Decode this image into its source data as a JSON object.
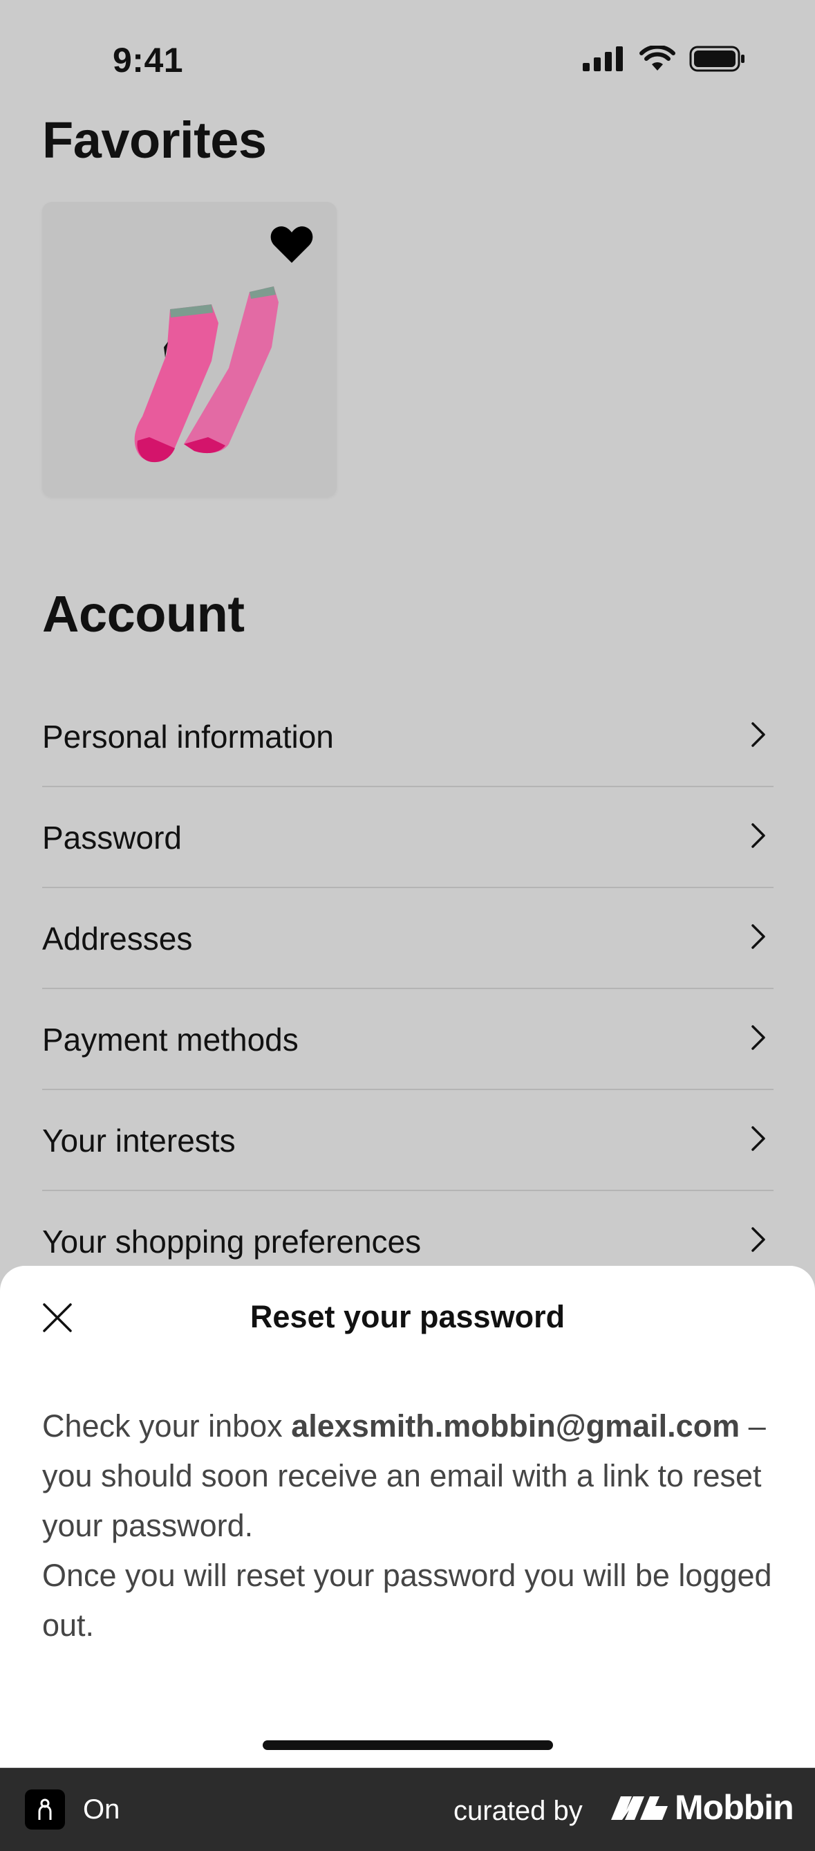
{
  "status_bar": {
    "time": "9:41"
  },
  "favorites": {
    "title": "Favorites",
    "item": {
      "image": "pink-ankle-socks",
      "favorited": true
    }
  },
  "account": {
    "title": "Account",
    "items": [
      {
        "label": "Personal information"
      },
      {
        "label": "Password"
      },
      {
        "label": "Addresses"
      },
      {
        "label": "Payment methods"
      },
      {
        "label": "Your interests"
      },
      {
        "label": "Your shopping preferences"
      }
    ]
  },
  "sheet": {
    "title": "Reset your password",
    "body_intro": "Check your inbox ",
    "email": "alexsmith.mobbin@gmail.com",
    "body_rest": " – you should soon receive an email with a link to reset your password.",
    "body_second": "Once you will reset your password you will be logged out."
  },
  "footer": {
    "app_name": "On",
    "curated_by": "curated by",
    "brand": "Mobbin"
  },
  "colors": {
    "overlay_bg": "#cbcbcb",
    "sheet_bg": "#ffffff",
    "footer_bg": "#2c2c2c",
    "sock_pink": "#e85b9c",
    "sock_toe": "#d4146b"
  }
}
